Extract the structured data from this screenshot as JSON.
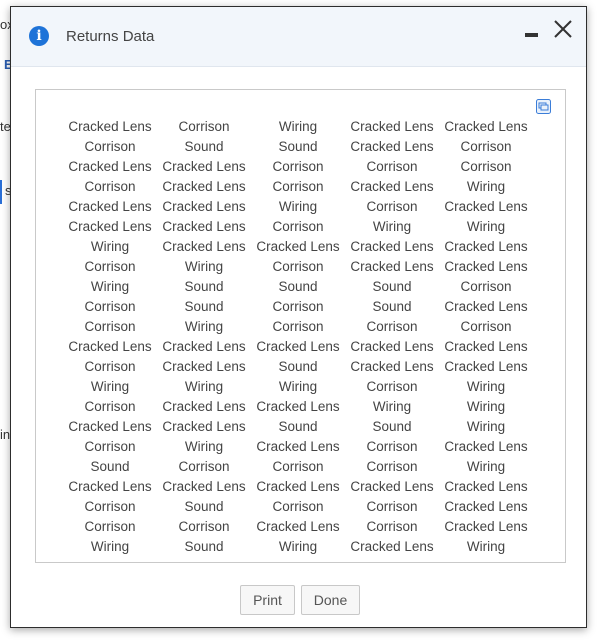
{
  "background": {
    "fragments": [
      "ox",
      "E",
      "te",
      "s",
      "in"
    ]
  },
  "dialog": {
    "title": "Returns Data",
    "icons": {
      "info": "info-icon",
      "minimize": "minimize-icon",
      "close": "close-icon",
      "popout": "popout-icon"
    },
    "rows": [
      [
        "Cracked Lens",
        "Corrison",
        "Wiring",
        "Cracked Lens",
        "Cracked Lens"
      ],
      [
        "Corrison",
        "Sound",
        "Sound",
        "Cracked Lens",
        "Corrison"
      ],
      [
        "Cracked Lens",
        "Cracked Lens",
        "Corrison",
        "Corrison",
        "Corrison"
      ],
      [
        "Corrison",
        "Cracked Lens",
        "Corrison",
        "Cracked Lens",
        "Wiring"
      ],
      [
        "Cracked Lens",
        "Cracked Lens",
        "Wiring",
        "Corrison",
        "Cracked Lens"
      ],
      [
        "Cracked Lens",
        "Cracked Lens",
        "Corrison",
        "Wiring",
        "Wiring"
      ],
      [
        "Wiring",
        "Cracked Lens",
        "Cracked Lens",
        "Cracked Lens",
        "Cracked Lens"
      ],
      [
        "Corrison",
        "Wiring",
        "Corrison",
        "Cracked Lens",
        "Cracked Lens"
      ],
      [
        "Wiring",
        "Sound",
        "Sound",
        "Sound",
        "Corrison"
      ],
      [
        "Corrison",
        "Sound",
        "Corrison",
        "Sound",
        "Cracked Lens"
      ],
      [
        "Corrison",
        "Wiring",
        "Corrison",
        "Corrison",
        "Corrison"
      ],
      [
        "Cracked Lens",
        "Cracked Lens",
        "Cracked Lens",
        "Cracked Lens",
        "Cracked Lens"
      ],
      [
        "Corrison",
        "Cracked Lens",
        "Sound",
        "Cracked Lens",
        "Cracked Lens"
      ],
      [
        "Wiring",
        "Wiring",
        "Wiring",
        "Corrison",
        "Wiring"
      ],
      [
        "Corrison",
        "Cracked Lens",
        "Cracked Lens",
        "Wiring",
        "Wiring"
      ],
      [
        "Cracked Lens",
        "Cracked Lens",
        "Sound",
        "Sound",
        "Wiring"
      ],
      [
        "Corrison",
        "Wiring",
        "Cracked Lens",
        "Corrison",
        "Cracked Lens"
      ],
      [
        "Sound",
        "Corrison",
        "Corrison",
        "Corrison",
        "Wiring"
      ],
      [
        "Cracked Lens",
        "Cracked Lens",
        "Cracked Lens",
        "Cracked Lens",
        "Cracked Lens"
      ],
      [
        "Corrison",
        "Sound",
        "Corrison",
        "Corrison",
        "Cracked Lens"
      ],
      [
        "Corrison",
        "Corrison",
        "Cracked Lens",
        "Corrison",
        "Cracked Lens"
      ],
      [
        "Wiring",
        "Sound",
        "Wiring",
        "Cracked Lens",
        "Wiring"
      ]
    ],
    "buttons": {
      "print": "Print",
      "done": "Done"
    }
  }
}
